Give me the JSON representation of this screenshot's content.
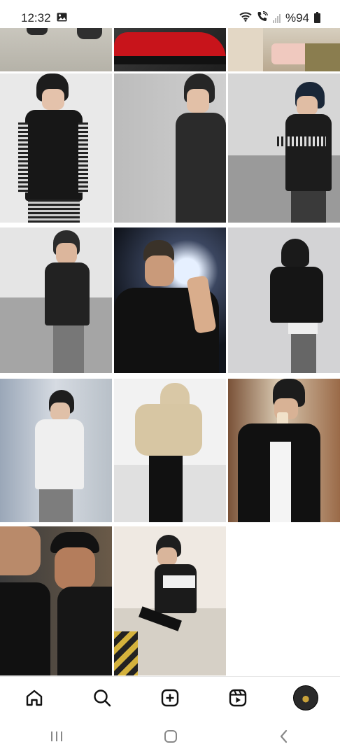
{
  "status": {
    "time": "12:32",
    "battery": "%94"
  },
  "icons": {
    "gallery": "image-icon",
    "wifi": "wifi-icon",
    "call": "wifi-call-icon",
    "signal": "signal-icon",
    "battery": "battery-icon",
    "home": "home-icon",
    "search": "search-icon",
    "create": "add-post-icon",
    "reels": "reels-icon",
    "profile": "profile-avatar",
    "recents": "recent-apps-icon",
    "sys_home": "system-home-icon",
    "back": "back-icon"
  },
  "grid": {
    "columns": 3,
    "rows": 5,
    "visible_photos": 14
  },
  "colors": {
    "accent": "#000000",
    "background": "#ffffff"
  }
}
